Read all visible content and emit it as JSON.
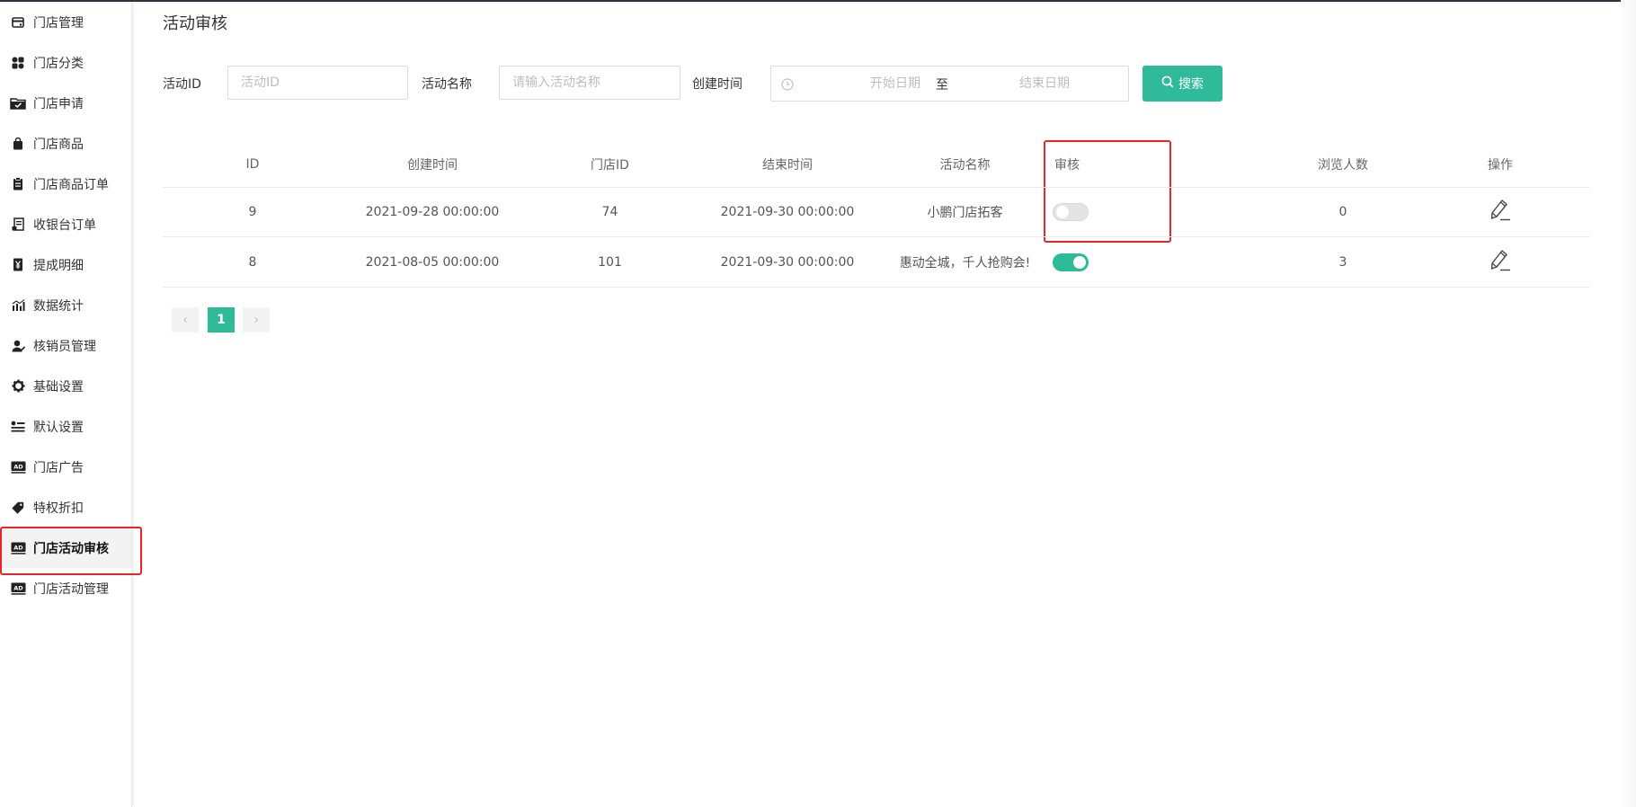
{
  "sidebar": {
    "items": [
      {
        "label": "门店管理",
        "icon": "store-card-icon"
      },
      {
        "label": "门店分类",
        "icon": "category-grid-icon"
      },
      {
        "label": "门店申请",
        "icon": "folder-check-icon"
      },
      {
        "label": "门店商品",
        "icon": "shopping-bag-icon"
      },
      {
        "label": "门店商品订单",
        "icon": "clipboard-icon"
      },
      {
        "label": "收银台订单",
        "icon": "receipt-icon"
      },
      {
        "label": "提成明细",
        "icon": "yen-doc-icon"
      },
      {
        "label": "数据统计",
        "icon": "bar-chart-icon"
      },
      {
        "label": "核销员管理",
        "icon": "user-edit-icon"
      },
      {
        "label": "基础设置",
        "icon": "gear-icon"
      },
      {
        "label": "默认设置",
        "icon": "list-settings-icon"
      },
      {
        "label": "门店广告",
        "icon": "ad-icon"
      },
      {
        "label": "特权折扣",
        "icon": "tag-icon"
      },
      {
        "label": "门店活动审核",
        "icon": "ad-icon",
        "active": true
      },
      {
        "label": "门店活动管理",
        "icon": "ad-icon"
      }
    ]
  },
  "page": {
    "title": "活动审核"
  },
  "filters": {
    "id_label": "活动ID",
    "id_placeholder": "活动ID",
    "name_label": "活动名称",
    "name_placeholder": "请输入活动名称",
    "time_label": "创建时间",
    "start_placeholder": "开始日期",
    "separator": "至",
    "end_placeholder": "结束日期",
    "search_label": "搜索"
  },
  "table": {
    "headers": [
      "ID",
      "创建时间",
      "门店ID",
      "结束时间",
      "活动名称",
      "审核",
      "浏览人数",
      "操作"
    ],
    "rows": [
      {
        "id": "9",
        "created": "2021-09-28 00:00:00",
        "store_id": "74",
        "end": "2021-09-30 00:00:00",
        "name": "小鹏门店拓客",
        "approved": false,
        "views": "0"
      },
      {
        "id": "8",
        "created": "2021-08-05 00:00:00",
        "store_id": "101",
        "end": "2021-09-30 00:00:00",
        "name": "惠动全城，千人抢购会!",
        "approved": true,
        "views": "3"
      }
    ]
  },
  "pagination": {
    "prev": "‹",
    "current": "1",
    "next": "›"
  },
  "colors": {
    "accent": "#2fbb99",
    "highlight": "#e8262a"
  }
}
